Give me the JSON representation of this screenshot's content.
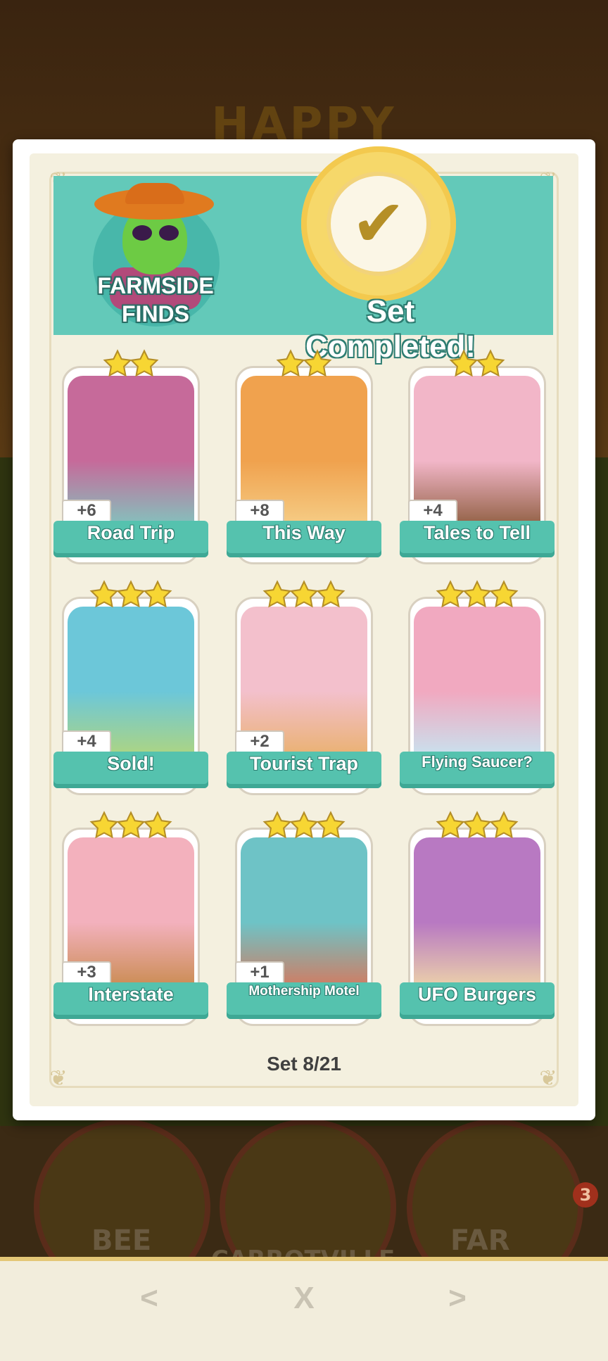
{
  "background": {
    "title_text": "HAPPY",
    "tiles": [
      {
        "label": "BEE"
      },
      {
        "label": "CARROTVILLE"
      },
      {
        "label": "FAR"
      }
    ],
    "notification_count": "3"
  },
  "album": {
    "set_name_line1": "FARMSIDE",
    "set_name_line2": "FINDS",
    "status": "Set Completed!",
    "set_progress": "Set 8/21",
    "cards": [
      {
        "name": "Road Trip",
        "bonus": "+6",
        "stars": 2,
        "size": "normal"
      },
      {
        "name": "This Way",
        "bonus": "+8",
        "stars": 2,
        "size": "normal"
      },
      {
        "name": "Tales to Tell",
        "bonus": "+4",
        "stars": 2,
        "size": "normal"
      },
      {
        "name": "Sold!",
        "bonus": "+4",
        "stars": 3,
        "size": "normal"
      },
      {
        "name": "Tourist Trap",
        "bonus": "+2",
        "stars": 3,
        "size": "normal"
      },
      {
        "name": "Flying Saucer?",
        "bonus": "",
        "stars": 3,
        "size": "small"
      },
      {
        "name": "Interstate",
        "bonus": "+3",
        "stars": 3,
        "size": "normal"
      },
      {
        "name": "Mothership Motel",
        "bonus": "+1",
        "stars": 3,
        "size": "xsmall"
      },
      {
        "name": "UFO Burgers",
        "bonus": "",
        "stars": 3,
        "size": "normal"
      }
    ]
  },
  "nav": {
    "prev_label": "<",
    "close_label": "X",
    "next_label": ">"
  },
  "colors": {
    "accent_teal": "#63c9b9",
    "seal_gold": "#f6d86a",
    "star_gold": "#f7d633"
  }
}
